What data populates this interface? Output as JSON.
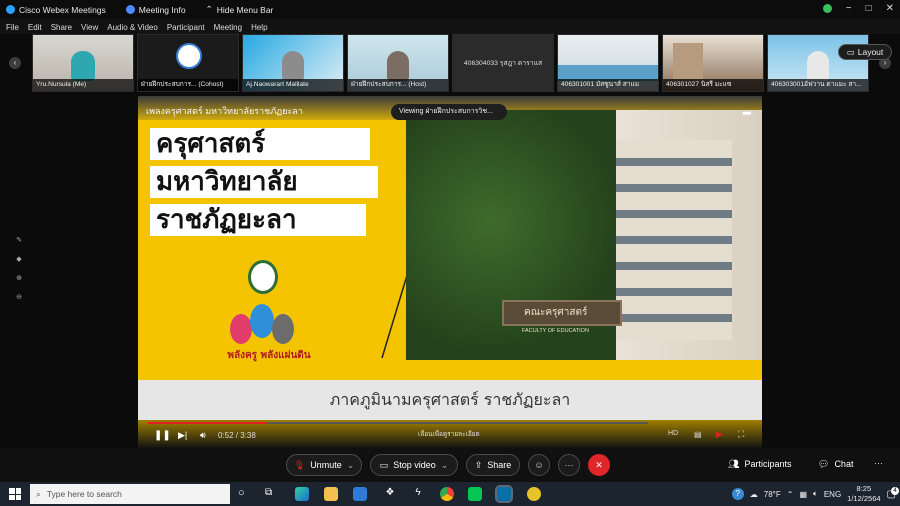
{
  "titlebar": {
    "items": [
      "Cisco Webex Meetings",
      "Meeting Info",
      "Hide Menu Bar"
    ],
    "controls": [
      "−",
      "□",
      "✕"
    ]
  },
  "menubar": {
    "items": [
      "File",
      "Edit",
      "Share",
      "View",
      "Audio & Video",
      "Participant",
      "Meeting",
      "Help"
    ]
  },
  "participants": [
    {
      "name": "Yru.Nursula  (Me)"
    },
    {
      "name": "ฝ่ายฝึกประสบการ... (Cohost)"
    },
    {
      "name": "Aj.Naowarart Malilate"
    },
    {
      "name": "ฝ่ายฝึกประสบการ... (Host)"
    },
    {
      "name": "",
      "center_text": "406304033 รุสฎา ดาราแส"
    },
    {
      "name": "406301001 มัสซูนาส์ สาแม"
    },
    {
      "name": "406301027 นิสรี มะแซ"
    },
    {
      "name": "406303001อัฟวาน ดาแมะ สา..."
    }
  ],
  "layout_button": "Layout",
  "shared": {
    "header": "เพลงครุศาสตร์ มหาวิทยาลัยราชภัฏยะลา",
    "banner_lines": [
      "ครุศาสตร์",
      "มหาวิทยาลัย",
      "ราชภัฏยะลา"
    ],
    "logo_caption": "พลังครู พลังแผ่นดิน",
    "sign_text": "คณะครุศาสตร์",
    "sign_sub": "FACULTY OF EDUCATION",
    "lower_title": "ภาคภูมินามครุศาสตร์ ราชภัฏยะลา",
    "viewing": "Viewing ฝ่ายฝึกประสบการวิช...",
    "player": {
      "time": "0:52 / 3:38",
      "scroll_hint": "เลื่อนเพื่อดูรายละเอียด",
      "progress_fraction": 0.24
    }
  },
  "controls": {
    "unmute": "Unmute",
    "stop_video": "Stop video",
    "share": "Share",
    "participants": "Participants",
    "chat": "Chat",
    "more": "···"
  },
  "taskbar": {
    "search_placeholder": "Type here to search",
    "weather": "78°F",
    "lang": "ENG",
    "time": "8:25",
    "date": "1/12/2564",
    "notifications": "4"
  },
  "colors": {
    "accent_yellow": "#f5c400",
    "end_red": "#e0262b",
    "progress_red": "#e02020",
    "taskbar": "#1c2430"
  }
}
